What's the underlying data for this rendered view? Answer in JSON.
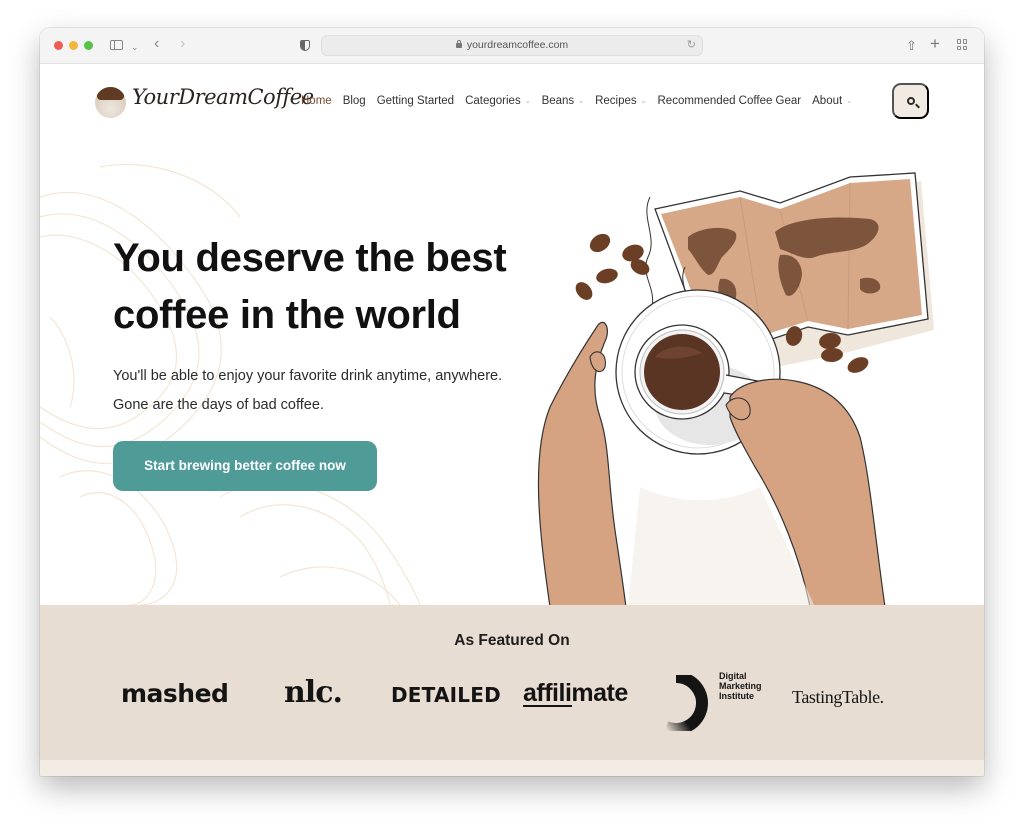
{
  "browser": {
    "url": "yourdreamcoffee.com",
    "icons": {
      "sidebar": "sidebar-icon",
      "back": "‹",
      "forward": "›",
      "share": "⇧",
      "new_tab": "+",
      "reload": "↻"
    }
  },
  "header": {
    "logo_text": "YourDreamCoffee",
    "nav": [
      {
        "label": "Home",
        "active": true,
        "has_dropdown": false
      },
      {
        "label": "Blog",
        "active": false,
        "has_dropdown": false
      },
      {
        "label": "Getting Started",
        "active": false,
        "has_dropdown": false
      },
      {
        "label": "Categories",
        "active": false,
        "has_dropdown": true
      },
      {
        "label": "Beans",
        "active": false,
        "has_dropdown": true
      },
      {
        "label": "Recipes",
        "active": false,
        "has_dropdown": true
      },
      {
        "label": "Recommended Coffee Gear",
        "active": false,
        "has_dropdown": false
      },
      {
        "label": "About",
        "active": false,
        "has_dropdown": true
      }
    ],
    "caret": "⌄",
    "search_icon": "search-icon"
  },
  "hero": {
    "title_line1": "You deserve the best",
    "title_line2": "coffee in the world",
    "subtitle_line1": "You'll be able to enjoy your favorite drink anytime, anywhere.",
    "subtitle_line2": "Gone are the days of bad coffee.",
    "cta_label": "Start brewing better coffee now",
    "illustration_alt": "Hands holding a cup of coffee over a world map with coffee beans"
  },
  "featured": {
    "title": "As Featured On",
    "brands": {
      "mashed": "mashed",
      "nlc": "nlc.",
      "detailed": "DETAILED",
      "affilimate": "affilimate",
      "dmi_line1": "Digital",
      "dmi_line2": "Marketing",
      "dmi_line3": "Institute",
      "tasting": "TastingTable."
    }
  },
  "colors": {
    "accent": "#4e9b98",
    "nav_active": "#7a4a33",
    "featured_bg": "#e7ddd2",
    "search_bg": "#f2ebe4"
  }
}
